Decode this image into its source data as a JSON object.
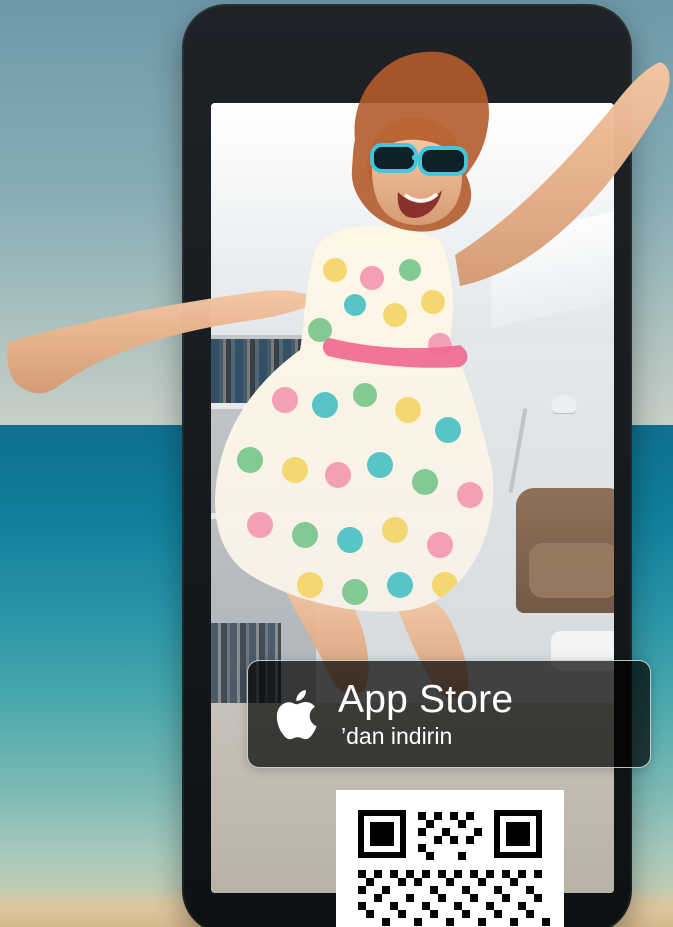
{
  "badge": {
    "title": "App Store",
    "subtitle": "’dan indirin",
    "icon": "apple-logo-icon"
  },
  "qr": {
    "icon": "qr-code"
  },
  "colors": {
    "badge_bg": "#000000",
    "badge_text": "#ffffff",
    "phone_frame": "#1f2328"
  }
}
